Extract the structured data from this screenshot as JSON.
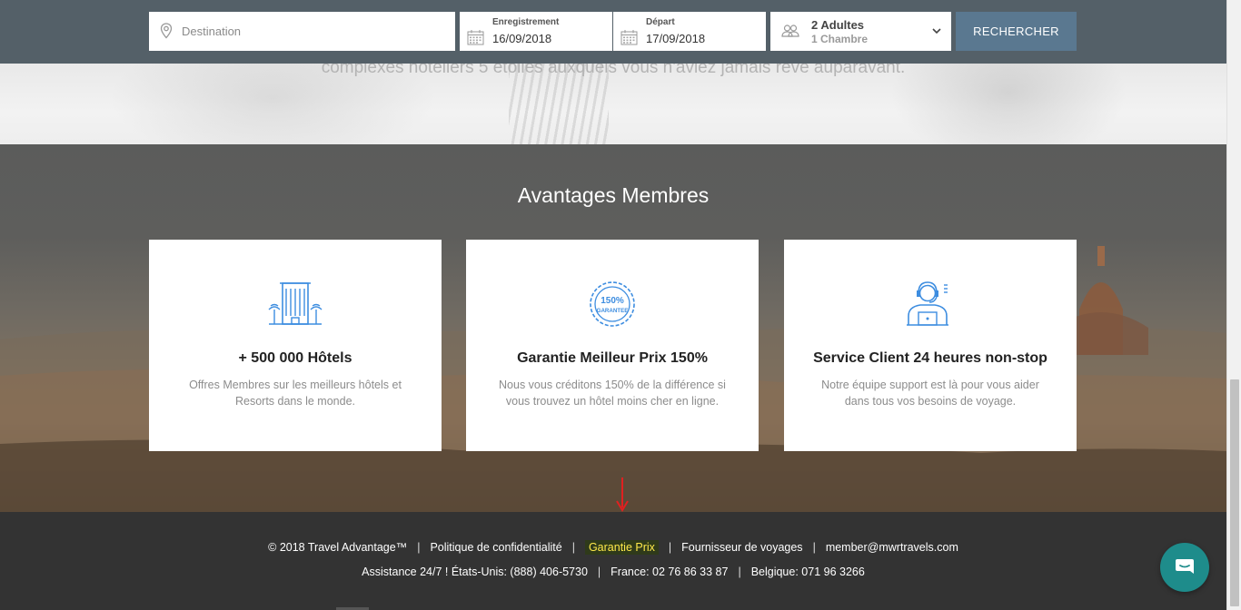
{
  "search": {
    "destination_placeholder": "Destination",
    "checkin_label": "Enregistrement",
    "checkin_value": "16/09/2018",
    "checkout_label": "Départ",
    "checkout_value": "17/09/2018",
    "guests_adults": "2 Adultes",
    "guests_rooms": "1 Chambre",
    "search_button": "RECHERCHER"
  },
  "hero": {
    "text": "complexes hôteliers 5 étoiles auxquels vous n'aviez jamais rêvé auparavant."
  },
  "benefits": {
    "title": "Avantages Membres",
    "cards": [
      {
        "icon": "hotel-building-icon",
        "title": "+ 500 000 Hôtels",
        "text": "Offres Membres sur les meilleurs hôtels et Resorts dans le monde."
      },
      {
        "icon": "guarantee-badge-icon",
        "badge_top": "150%",
        "badge_bottom": "GARANTEE",
        "title": "Garantie Meilleur Prix 150%",
        "text": "Nous vous créditons 150% de la différence si vous trouvez un hôtel moins cher en ligne."
      },
      {
        "icon": "support-agent-icon",
        "title": "Service Client 24 heures non-stop",
        "text": "Notre équipe support est là pour vous aider dans tous vos besoins de voyage."
      }
    ]
  },
  "footer": {
    "copyright": "© 2018 Travel Advantage™",
    "privacy": "Politique de confidentialité",
    "price_guarantee": "Garantie Prix",
    "suppliers": "Fournisseur de voyages",
    "email": "member@mwrtravels.com",
    "assistance": "Assistance 24/7 !  États-Unis: (888) 406-5730",
    "france": "France: 02 76 86 33 87",
    "belgium": "Belgique: 071 96 3266",
    "separator": "|"
  },
  "colors": {
    "search_bar_bg": "#546068",
    "search_button_bg": "#5a7890",
    "icon_blue": "#3d8de0",
    "footer_bg": "#333333",
    "chat_bg": "#1e8c8b",
    "highlight_text": "#ffe94a",
    "arrow_red": "#e02020"
  },
  "chat_widget": {
    "icon": "chat-bubble-icon"
  }
}
